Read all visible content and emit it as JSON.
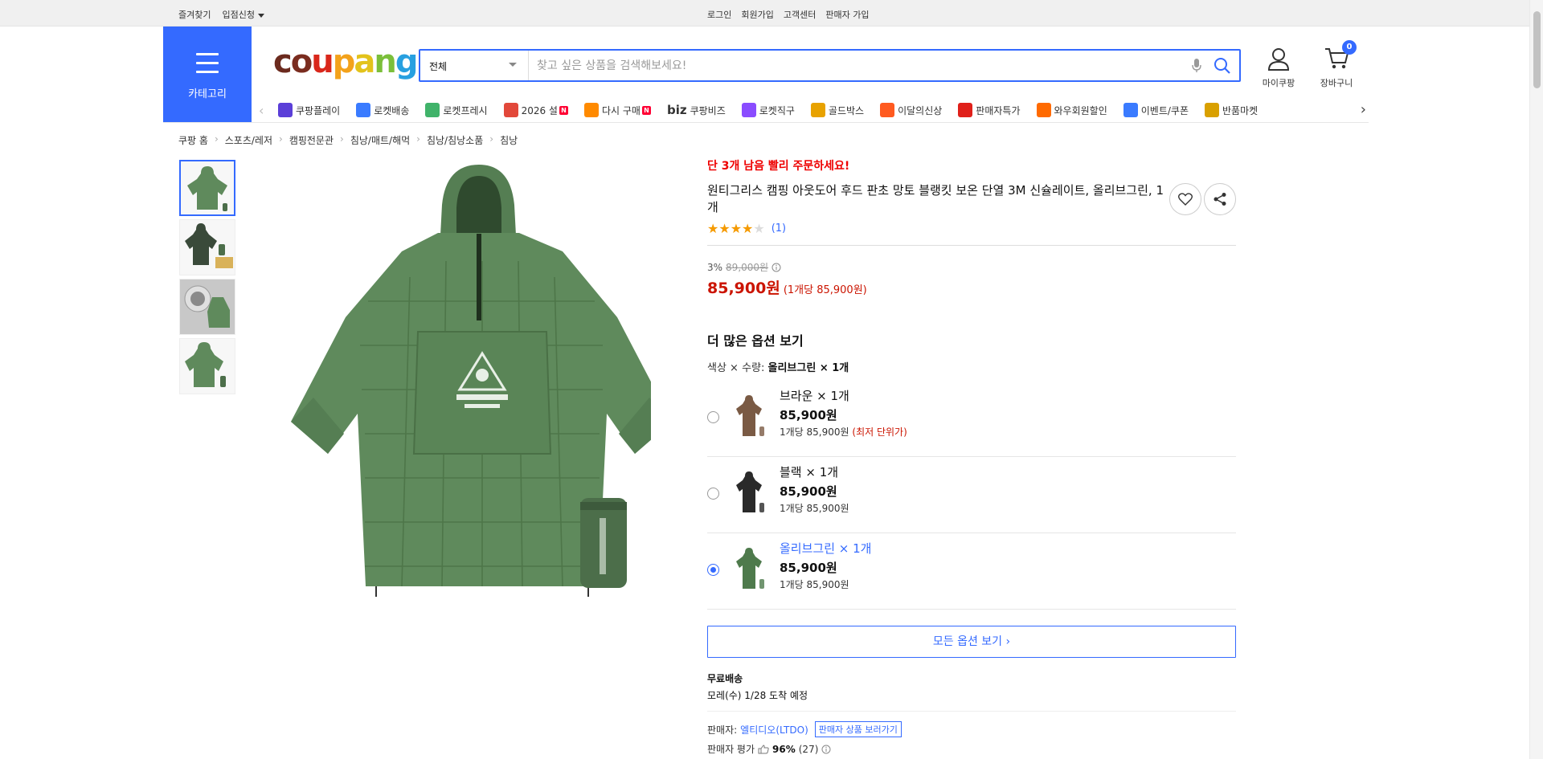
{
  "topbar": {
    "favorites": "즐겨찾기",
    "apply": "입점신청",
    "login": "로그인",
    "signup": "회원가입",
    "service": "고객센터",
    "seller_signup": "판매자 가입"
  },
  "header": {
    "category_label": "카테고리",
    "logo_letters": [
      "c",
      "o",
      "u",
      "p",
      "a",
      "n",
      "g"
    ],
    "search_scope": "전체",
    "search_placeholder": "찾고 싶은 상품을 검색해보세요!",
    "my_label": "마이쿠팡",
    "cart_label": "장바구니",
    "cart_count": "0"
  },
  "nav": {
    "items": [
      {
        "label": "쿠팡플레이",
        "color": "#5b3fd8",
        "new": false
      },
      {
        "label": "로켓배송",
        "color": "#3a7bff",
        "new": false
      },
      {
        "label": "로켓프레시",
        "color": "#40b36a",
        "new": false
      },
      {
        "label": "2026 설",
        "color": "#e2483a",
        "new": true
      },
      {
        "label": "다시 구매",
        "color": "#ff8a00",
        "new": true
      },
      {
        "label": "쿠팡비즈",
        "color": "#222222",
        "new": false
      },
      {
        "label": "로켓직구",
        "color": "#8a4cff",
        "new": false
      },
      {
        "label": "골드박스",
        "color": "#e8a200",
        "new": false
      },
      {
        "label": "이달의신상",
        "color": "#ff5a1f",
        "new": false
      },
      {
        "label": "판매자특가",
        "color": "#e0201a",
        "new": false
      },
      {
        "label": "와우회원할인",
        "color": "#ff6a00",
        "new": false
      },
      {
        "label": "이벤트/쿠폰",
        "color": "#3a7bff",
        "new": false
      },
      {
        "label": "반품마켓",
        "color": "#d9a000",
        "new": false
      }
    ],
    "biz_prefix": "biz",
    "new_badge": "N"
  },
  "breadcrumb": [
    "쿠팡 홈",
    "스포츠/레저",
    "캠핑전문관",
    "침낭/매트/해먹",
    "침낭/침낭소품",
    "침낭"
  ],
  "product": {
    "urgent": "단 3개 남음 빨리 주문하세요!",
    "title": "원티그리스 캠핑 아웃도어 후드 판초 망토 블랭킷 보온 단열 3M 신슐레이트, 올리브그린, 1개",
    "rating_stars": 4,
    "rating_count": "(1)",
    "discount": "3%",
    "original_price": "89,000원",
    "price": "85,900원",
    "unit_price": "(1개당 85,900원)",
    "more_options": "더 많은 옵션 보기",
    "option_label": "색상 × 수량: ",
    "option_value": "올리브그린 × 1개",
    "options": [
      {
        "name": "브라운 × 1개",
        "price": "85,900원",
        "unit": "1개당 85,900원",
        "tag": "(최저 단위가)",
        "selected": false,
        "color": "#7a5a44"
      },
      {
        "name": "블랙 × 1개",
        "price": "85,900원",
        "unit": "1개당 85,900원",
        "tag": "",
        "selected": false,
        "color": "#2a2a2a"
      },
      {
        "name": "올리브그린 × 1개",
        "price": "85,900원",
        "unit": "1개당 85,900원",
        "tag": "",
        "selected": true,
        "color": "#4e7a4c"
      }
    ],
    "all_options": "모든 옵션 보기 ›",
    "shipping_title": "무료배송",
    "shipping_date": "모레(수) 1/28 도착 예정",
    "seller_label": "판매자:",
    "seller_name": "엘티디오(LTDO)",
    "seller_link": "판매자 상품 보러가기",
    "seller_rating_label": "판매자 평가",
    "seller_rating": "96%",
    "seller_rating_count": "(27)"
  },
  "colors": {
    "accent": "#346aff",
    "price_red": "#cb1400",
    "product_green": "#5f8a5c"
  }
}
